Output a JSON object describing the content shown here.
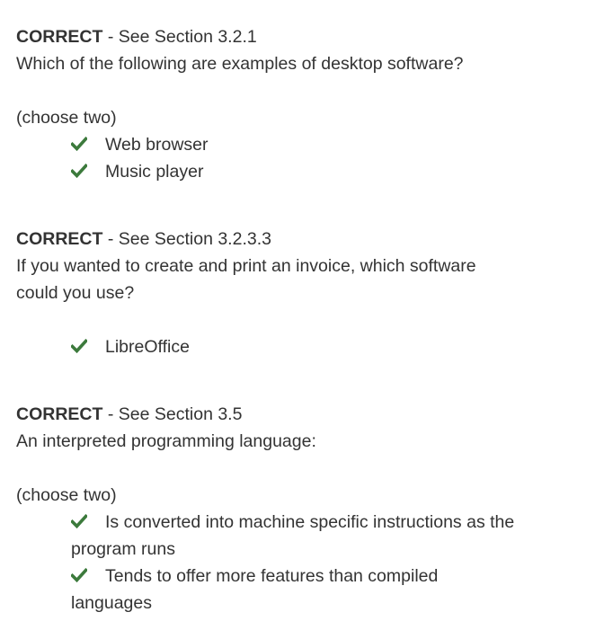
{
  "check_color": "#3c7a3c",
  "icon": "check-icon",
  "questions": [
    {
      "status": "CORRECT",
      "separator": " - ",
      "reference": "See Section 3.2.1",
      "text": "Which of the following are examples of desktop software?",
      "hint": "(choose two)",
      "answers": [
        "Web browser",
        "Music player"
      ]
    },
    {
      "status": "CORRECT",
      "separator": " - ",
      "reference": "See Section 3.2.3.3",
      "text_lines": [
        "If you wanted to create and print an invoice, which software",
        "could you use?"
      ],
      "answers": [
        "LibreOffice"
      ]
    },
    {
      "status": "CORRECT",
      "separator": " - ",
      "reference": "See Section 3.5",
      "text": "An interpreted programming language:",
      "hint": "(choose two)",
      "answers": [
        [
          "Is converted into machine specific instructions as the",
          "program runs"
        ],
        [
          "Tends to offer more features than compiled",
          "languages"
        ]
      ]
    }
  ]
}
